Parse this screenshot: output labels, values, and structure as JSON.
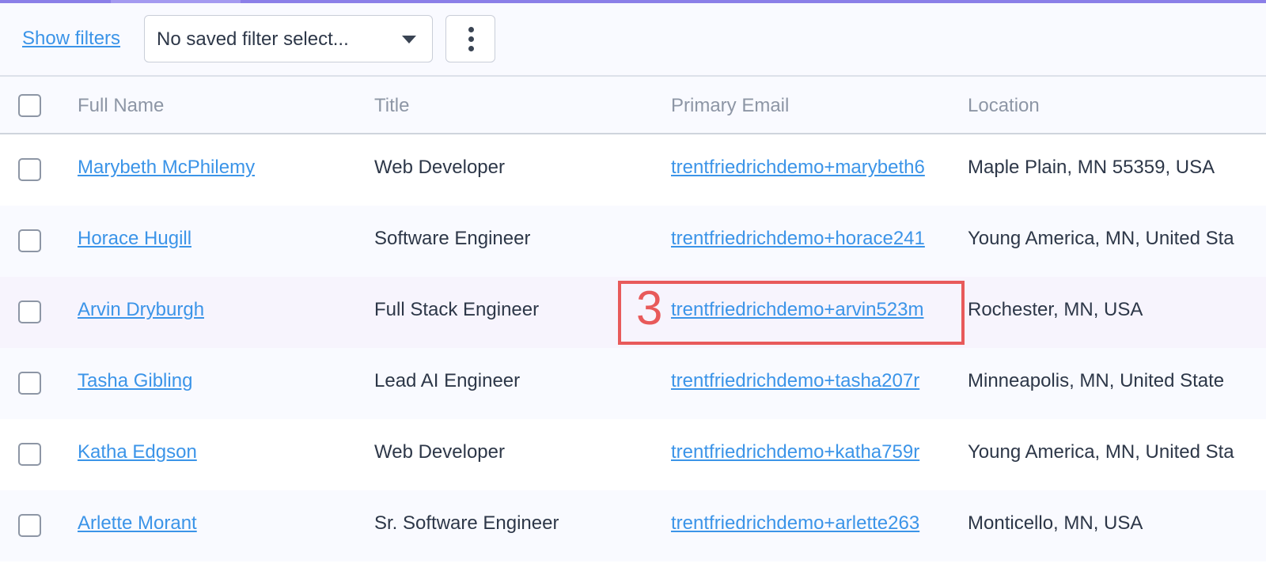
{
  "toolbar": {
    "show_filters_label": "Show filters",
    "saved_filter_value": "No saved filter select...",
    "more_icon": "vertical-ellipsis-icon"
  },
  "table": {
    "columns": [
      "Full Name",
      "Title",
      "Primary Email",
      "Location"
    ],
    "rows": [
      {
        "name": "Marybeth McPhilemy",
        "title": "Web Developer",
        "email": "trentfriedrichdemo+marybeth6",
        "location": "Maple Plain, MN 55359, USA"
      },
      {
        "name": "Horace Hugill",
        "title": "Software Engineer",
        "email": "trentfriedrichdemo+horace241",
        "location": "Young America, MN, United Sta"
      },
      {
        "name": "Arvin Dryburgh",
        "title": "Full Stack Engineer",
        "email": "trentfriedrichdemo+arvin523m",
        "location": "Rochester, MN, USA"
      },
      {
        "name": "Tasha Gibling",
        "title": "Lead AI Engineer",
        "email": "trentfriedrichdemo+tasha207r",
        "location": "Minneapolis, MN, United State"
      },
      {
        "name": "Katha Edgson",
        "title": "Web Developer",
        "email": "trentfriedrichdemo+katha759r",
        "location": "Young America, MN, United Sta"
      },
      {
        "name": "Arlette Morant",
        "title": "Sr. Software Engineer",
        "email": "trentfriedrichdemo+arlette263",
        "location": "Monticello, MN, USA"
      }
    ]
  },
  "annotation": {
    "label": "3",
    "color": "#e85a5a"
  },
  "colors": {
    "link": "#3b94e8",
    "accent": "#8b7fe8"
  }
}
